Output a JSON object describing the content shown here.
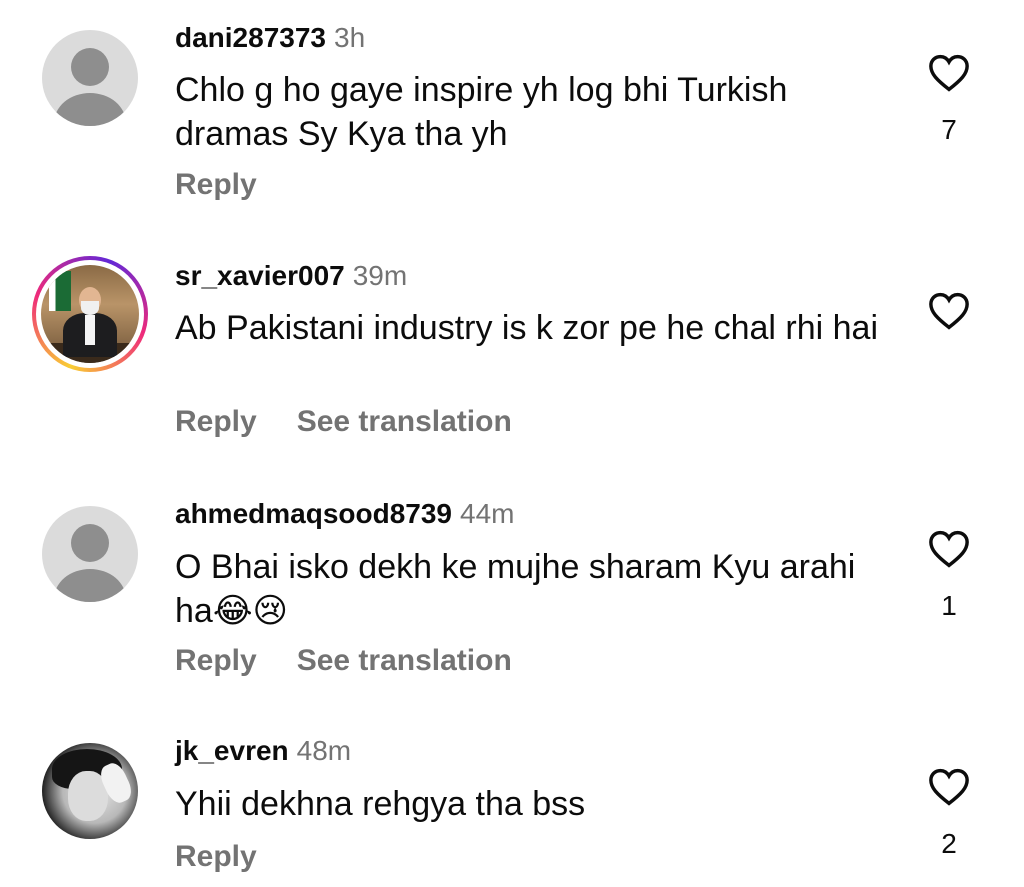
{
  "comments": [
    {
      "username": "dani287373",
      "time": "3h",
      "text": "Chlo g ho gaye inspire yh log bhi Turkish dramas Sy Kya tha yh",
      "reply": "Reply",
      "likes": "7",
      "avatar": "default-avatar"
    },
    {
      "username": "sr_xavier007",
      "time": "39m",
      "text": "Ab Pakistani industry is k zor pe he chal rhi hai",
      "reply": "Reply",
      "translate": "See translation",
      "likes": "",
      "avatar": "story-photo-avatar"
    },
    {
      "username": "ahmedmaqsood8739",
      "time": "44m",
      "text": "O Bhai isko dekh ke mujhe sharam Kyu arahi ha😂😢",
      "reply": "Reply",
      "translate": "See translation",
      "likes": "1",
      "avatar": "default-avatar"
    },
    {
      "username": "jk_evren",
      "time": "48m",
      "text": "Yhii dekhna rehgya tha bss",
      "reply": "Reply",
      "likes": "2",
      "avatar": "photo-avatar"
    }
  ],
  "icons": {
    "like": "heart-outline-icon"
  },
  "colors": {
    "primary_text": "#0c0c0c",
    "secondary_text": "#737373",
    "story_ring": [
      "#f9ce34",
      "#ee2a7b",
      "#6228d7"
    ]
  }
}
